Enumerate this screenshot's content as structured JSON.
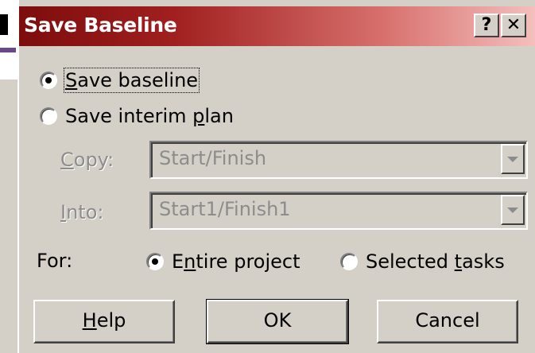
{
  "window": {
    "title": "Save Baseline",
    "help_button": "?",
    "close_button": "✕"
  },
  "options": {
    "save_baseline": {
      "label": "Save baseline",
      "selected": true
    },
    "save_interim": {
      "label": "Save interim plan",
      "selected": false
    }
  },
  "copy": {
    "label": "Copy:",
    "value": "Start/Finish",
    "enabled": false
  },
  "into": {
    "label": "Into:",
    "value": "Start1/Finish1",
    "enabled": false
  },
  "for": {
    "label": "For:",
    "entire_project": {
      "label": "Entire project",
      "selected": true
    },
    "selected_tasks": {
      "label": "Selected tasks",
      "selected": false
    }
  },
  "buttons": {
    "help": "Help",
    "ok": "OK",
    "cancel": "Cancel"
  },
  "colors": {
    "title_start": "#7d0c0c",
    "title_end": "#f4c0bd",
    "face": "#d4d0c8"
  }
}
